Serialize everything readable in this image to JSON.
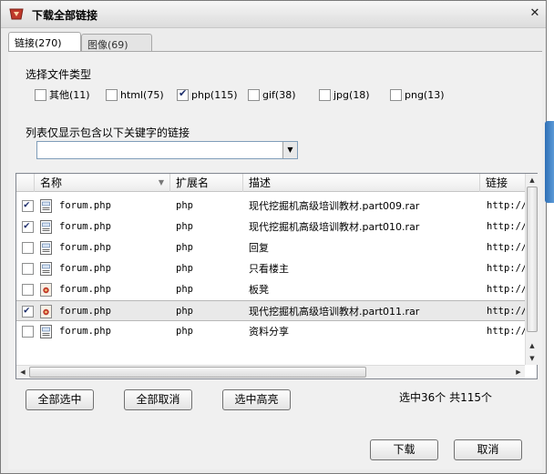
{
  "window": {
    "title": "下载全部链接",
    "close_glyph": "✕",
    "icon": "download-app-icon"
  },
  "tabs": [
    {
      "label": "链接(270)",
      "active": true
    },
    {
      "label": "图像(69)",
      "active": false
    }
  ],
  "file_types": {
    "label": "选择文件类型",
    "options": [
      {
        "label": "其他(11)",
        "checked": false
      },
      {
        "label": "html(75)",
        "checked": false
      },
      {
        "label": "php(115)",
        "checked": true
      },
      {
        "label": "gif(38)",
        "checked": false
      },
      {
        "label": "jpg(18)",
        "checked": false
      },
      {
        "label": "png(13)",
        "checked": false
      }
    ]
  },
  "filter": {
    "label": "列表仅显示包含以下关键字的链接",
    "value": "",
    "dropdown_icon": "chevron-down-icon"
  },
  "list": {
    "columns": [
      {
        "label": "名称",
        "sorted": true
      },
      {
        "label": "扩展名"
      },
      {
        "label": "描述"
      },
      {
        "label": "链接"
      }
    ],
    "rows": [
      {
        "checked": true,
        "name": "forum.php",
        "ext": "php",
        "desc": "现代挖掘机高级培训教材.part009.rar",
        "link": "http://",
        "icon": "page-icon",
        "selected": false
      },
      {
        "checked": true,
        "name": "forum.php",
        "ext": "php",
        "desc": "现代挖掘机高级培训教材.part010.rar",
        "link": "http://",
        "icon": "page-icon",
        "selected": false
      },
      {
        "checked": false,
        "name": "forum.php",
        "ext": "php",
        "desc": "回复",
        "link": "http://",
        "icon": "page-icon",
        "selected": false
      },
      {
        "checked": false,
        "name": "forum.php",
        "ext": "php",
        "desc": "只看楼主",
        "link": "http://",
        "icon": "page-icon",
        "selected": false
      },
      {
        "checked": false,
        "name": "forum.php",
        "ext": "php",
        "desc": "板凳",
        "link": "http://",
        "icon": "image-file-icon",
        "selected": false
      },
      {
        "checked": true,
        "name": "forum.php",
        "ext": "php",
        "desc": "现代挖掘机高级培训教材.part011.rar",
        "link": "http://",
        "icon": "image-file-icon",
        "selected": true
      },
      {
        "checked": false,
        "name": "forum.php",
        "ext": "php",
        "desc": "资料分享",
        "link": "http://",
        "icon": "page-icon",
        "selected": false
      }
    ]
  },
  "buttons": {
    "select_all": "全部选中",
    "deselect_all": "全部取消",
    "select_highlighted": "选中高亮",
    "download": "下载",
    "cancel": "取消"
  },
  "status": "选中36个 共115个",
  "colors": {
    "title_icon": "#c0392b",
    "selection": "#e9e9e9",
    "check": "#1b2d6b"
  }
}
